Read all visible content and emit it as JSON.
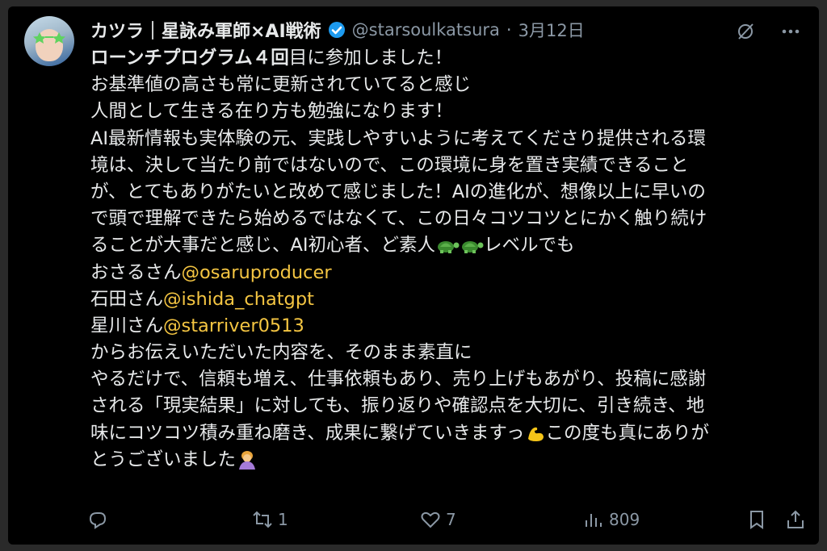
{
  "post": {
    "author_name": "カツラ｜星詠み軍師×AI戦術",
    "handle": "@starsoulkatsura",
    "dot": "·",
    "date": "3月12日",
    "line1_bold": "ローンチプログラム４回",
    "line1_rest": "目に参加しました！",
    "lines_a": [
      "お基準値の高さも常に更新されていてると感じ",
      "人間として生きる在り方も勉強になります！",
      "AI最新情報も実体験の元、実践しやすいように考えてくださり提供される環",
      "境は、決して当たり前ではないので、この環境に身を置き実績できること",
      "が、とてもありがたいと改めて感じました！AIの進化が、想像以上に早いの",
      "で頭で理解できたら始めるではなくて、この日々コツコツとにかく触り続け"
    ],
    "line_turtles_pre": "ることが大事だと感じ、AI初心者、ど素人",
    "line_turtles_post": "レベルでも",
    "mention1_prefix": "おさるさん",
    "mention1": "@osaruproducer",
    "mention2_prefix": "石田さん",
    "mention2": "@ishida_chatgpt",
    "mention3_prefix": "星川さん",
    "mention3": "@starriver0513",
    "lines_b": [
      "からお伝えいただいた内容を、そのまま素直に",
      "やるだけで、信頼も増え、仕事依頼もあり、売り上げもあがり、投稿に感謝",
      "される「現実結果」に対しても、振り返りや確認点を大切に、引き続き、地"
    ],
    "line_muscle_pre": "味にコツコツ積み重ね磨き、成果に繋げていきますっ",
    "line_muscle_post": "この度も真にありが",
    "line_last": "とうございました"
  },
  "actions": {
    "reposts": "1",
    "likes": "7",
    "views": "809"
  },
  "icons": [
    "verified-badge-icon",
    "grok-icon",
    "more-icon",
    "reply-icon",
    "repost-icon",
    "like-icon",
    "views-icon",
    "bookmark-icon",
    "share-icon",
    "turtle-emoji",
    "muscle-emoji",
    "bowing-person-emoji"
  ],
  "colors": {
    "background": "#000000",
    "text": "#e7e9ea",
    "muted": "#8b98a5",
    "mention": "#f4c542",
    "verified": "#1d9bf0"
  }
}
